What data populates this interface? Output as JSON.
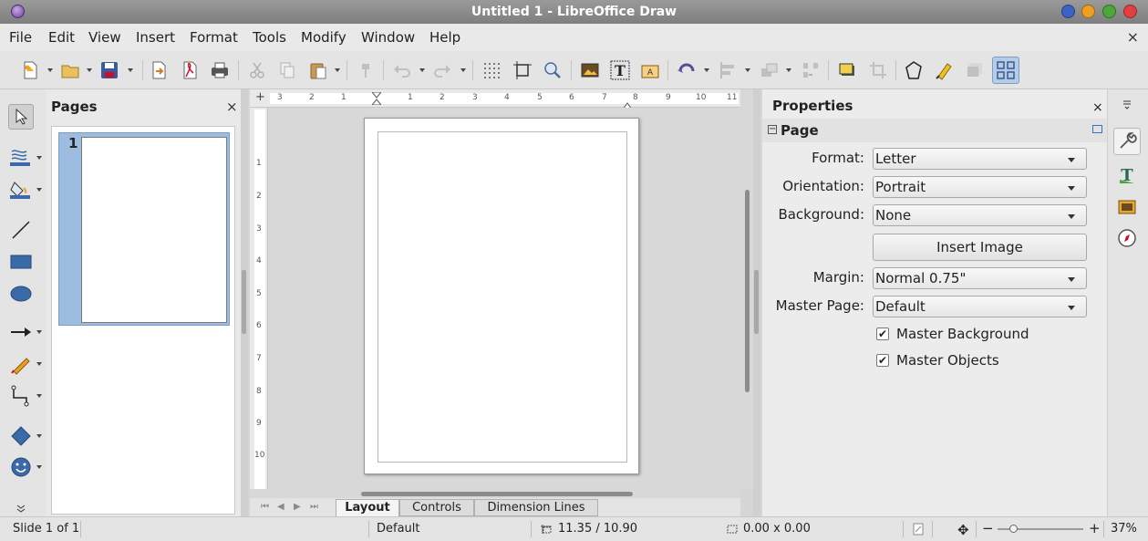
{
  "window": {
    "title": "Untitled 1 - LibreOffice Draw",
    "controls": [
      "minimize-icon",
      "restore-icon",
      "maximize-icon",
      "close-icon"
    ],
    "control_colors": [
      "#3a63c4",
      "#f0a020",
      "#4aa93a",
      "#e04040"
    ]
  },
  "menubar": {
    "items": [
      "File",
      "Edit",
      "View",
      "Insert",
      "Format",
      "Tools",
      "Modify",
      "Window",
      "Help"
    ],
    "close_label": "×"
  },
  "toolbar": {
    "icons": [
      "new-document-icon",
      "open-icon",
      "save-icon",
      "export-icon",
      "export-pdf-icon",
      "print-icon",
      "cut-icon",
      "copy-icon",
      "paste-icon",
      "clone-formatting-icon",
      "undo-icon",
      "redo-icon",
      "grid-icon",
      "helplines-icon",
      "zoom-pan-icon",
      "insert-image-icon",
      "insert-textbox-icon",
      "fontwork-icon",
      "rotate-icon",
      "align-icon",
      "arrange-icon",
      "distribute-icon",
      "shadow-icon",
      "crop-icon",
      "points-icon",
      "glue-points-icon",
      "extrusion-icon",
      "toggle-sidebar-icon"
    ]
  },
  "left_tools": {
    "icons": [
      "select-icon",
      "line-color-icon",
      "fill-color-icon",
      "line-icon",
      "rectangle-icon",
      "ellipse-icon",
      "lines-arrows-icon",
      "curves-polygons-icon",
      "connectors-icon",
      "basic-shapes-icon",
      "symbol-shapes-icon",
      "more-tools-icon"
    ]
  },
  "pages_panel": {
    "title": "Pages",
    "close_label": "×",
    "pages": [
      {
        "number": "1"
      }
    ]
  },
  "ruler": {
    "h_labels": [
      "3",
      "2",
      "1",
      "1",
      "2",
      "3",
      "4",
      "5",
      "6",
      "7",
      "8",
      "9",
      "10",
      "11"
    ],
    "v_labels": [
      "1",
      "2",
      "3",
      "4",
      "5",
      "6",
      "7",
      "8",
      "9",
      "10"
    ]
  },
  "tabs": {
    "items": [
      "Layout",
      "Controls",
      "Dimension Lines"
    ],
    "active": "Layout"
  },
  "properties": {
    "title": "Properties",
    "close_label": "×",
    "section": "Page",
    "collapse_label": "⊟",
    "format_label": "Format:",
    "format_value": "Letter",
    "orientation_label": "Orientation:",
    "orientation_value": "Portrait",
    "background_label": "Background:",
    "background_value": "None",
    "insert_image_label": "Insert Image",
    "margin_label": "Margin:",
    "margin_value": "Normal 0.75\"",
    "master_page_label": "Master Page:",
    "master_page_value": "Default",
    "master_background_label": "Master Background",
    "master_background_checked": true,
    "master_objects_label": "Master Objects",
    "master_objects_checked": true
  },
  "sidebar_tabs": {
    "icons": [
      "sidebar-menu-icon",
      "properties-icon",
      "styles-icon",
      "gallery-icon",
      "navigator-icon"
    ]
  },
  "statusbar": {
    "slide": "Slide 1 of 1",
    "master": "Default",
    "position": "11.35 / 10.90",
    "size": "0.00 x 0.00",
    "zoom": "37%",
    "zoom_level": 0.37
  },
  "colors": {
    "selection": "#9cbddf",
    "accent": "#3a72c0"
  }
}
